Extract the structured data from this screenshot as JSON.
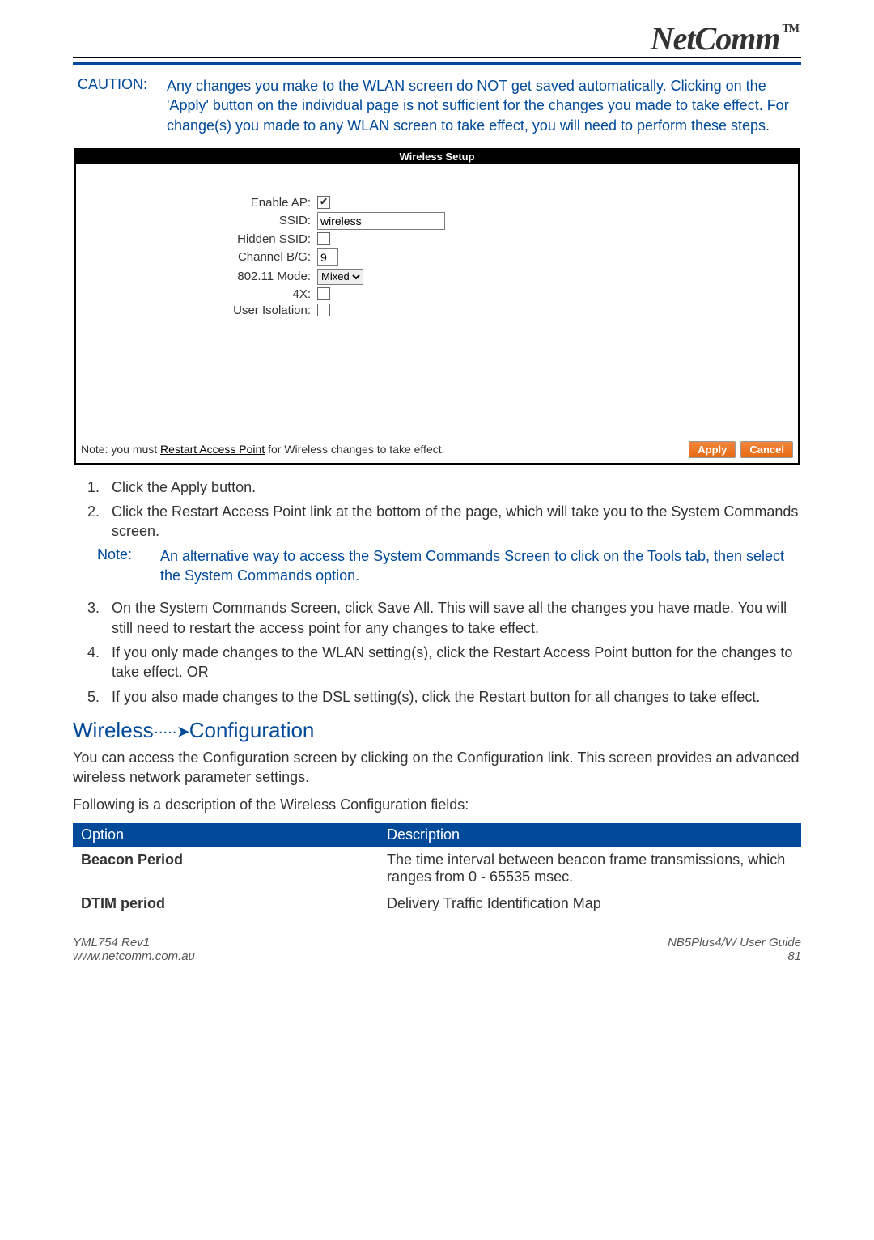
{
  "brand": {
    "name": "NetComm",
    "tm": "TM"
  },
  "caution": {
    "label": "CAUTION:",
    "text": "Any changes you make to the WLAN screen do NOT get saved automatically. Clicking on the 'Apply' button on the individual page is not sufficient for the changes you made to take effect. For change(s) you made to any WLAN screen to take effect, you will need to perform these steps."
  },
  "panel": {
    "title": "Wireless Setup",
    "rows": {
      "enable_ap": {
        "label": "Enable AP:",
        "checked": true
      },
      "ssid": {
        "label": "SSID:",
        "value": "wireless"
      },
      "hidden_ssid": {
        "label": "Hidden SSID:",
        "checked": false
      },
      "channel": {
        "label": "Channel B/G:",
        "value": "9"
      },
      "mode": {
        "label": "802.11 Mode:",
        "value": "Mixed"
      },
      "fourx": {
        "label": "4X:",
        "checked": false
      },
      "user_iso": {
        "label": "User Isolation:",
        "checked": false
      }
    },
    "footer": {
      "prefix": "Note: you must ",
      "link": "Restart Access Point",
      "suffix": " for Wireless changes to take effect.",
      "apply": "Apply",
      "cancel": "Cancel"
    }
  },
  "steps1": [
    "Click the Apply button.",
    "Click the Restart Access Point link at the bottom of the page, which will take you to the System Commands screen."
  ],
  "note": {
    "label": "Note:",
    "text": "An alternative way to access the System Commands Screen to click on the Tools tab, then select the System Commands option."
  },
  "steps2": [
    "On the System Commands Screen, click Save All.  This will save all the changes you have made. You will still need to restart the access point for any changes to take effect.",
    "If you only made changes to the WLAN setting(s), click the Restart Access Point button for the changes to take effect. OR",
    "If you also made changes to the DSL setting(s), click the Restart button for all changes to take effect."
  ],
  "section": {
    "title_pre": "Wireless",
    "title_post": "Configuration",
    "intro": "You can access the Configuration screen by clicking on the Configuration link.  This screen provides an advanced wireless network parameter settings.",
    "lead": "Following is a description of the Wireless Configuration fields:"
  },
  "table": {
    "head": {
      "opt": "Option",
      "desc": "Description"
    },
    "rows": [
      {
        "opt": "Beacon Period",
        "desc": "The time interval between beacon frame transmissions, which ranges from 0 - 65535 msec."
      },
      {
        "opt": "DTIM period",
        "desc": "Delivery Traffic Identification Map"
      }
    ]
  },
  "footer": {
    "left1": "YML754 Rev1",
    "left2": "www.netcomm.com.au",
    "right1": "NB5Plus4/W User Guide",
    "right2": "81"
  }
}
